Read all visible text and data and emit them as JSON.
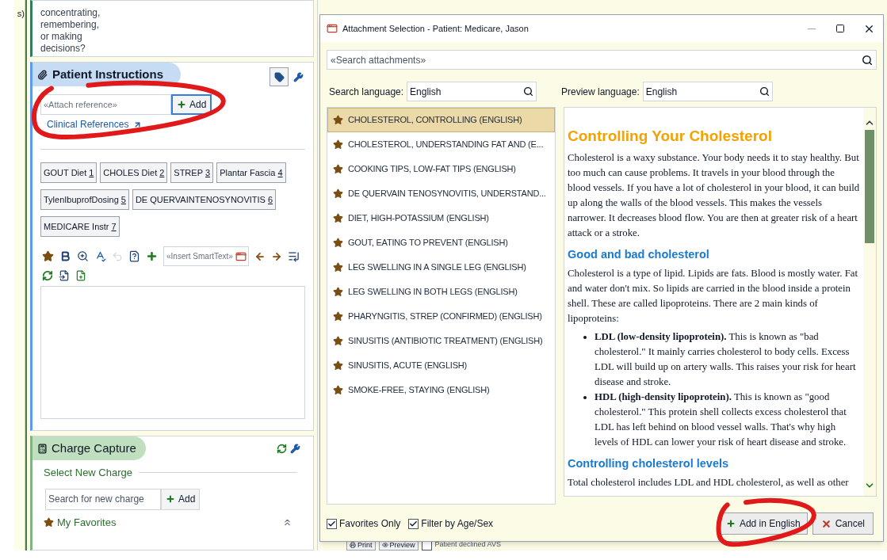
{
  "sidebar_fragment": {
    "text": "s)"
  },
  "question_card": {
    "lines": [
      "concentrating,",
      "remembering,",
      "or making",
      "decisions?"
    ]
  },
  "patient_instructions": {
    "title": "Patient Instructions",
    "attach_placeholder": "«Attach reference»",
    "add_button": "Add",
    "clinical_references_link": "Clinical References",
    "instructions": [
      {
        "label": "GOUT Diet",
        "number": "1"
      },
      {
        "label": "CHOLES Diet",
        "number": "2"
      },
      {
        "label": "STREP",
        "number": "3"
      },
      {
        "label": "Plantar Fascia",
        "number": "4"
      },
      {
        "label": "TylenIbuprofDosing",
        "number": "5"
      },
      {
        "label": "DE QUERVAINTENOSYNOVITIS",
        "number": "6"
      },
      {
        "label": "MEDICARE Instr",
        "number": "7"
      }
    ],
    "smarttext_placeholder": "«Insert SmartText»"
  },
  "charge_capture": {
    "title": "Charge Capture",
    "section_label": "Select New Charge",
    "search_placeholder": "Search for new charge",
    "add_button": "Add",
    "favorites_label": "My Favorites"
  },
  "background_footer": {
    "buttons": [
      "Print",
      "Preview"
    ],
    "checkbox": {
      "label": "Patient declined AVS",
      "checked": false
    }
  },
  "dialog": {
    "title": "Attachment Selection - Patient: Medicare, Jason",
    "search_placeholder": "«Search attachments»",
    "search_language": {
      "label": "Search language:",
      "value": "English"
    },
    "preview_language": {
      "label": "Preview language:",
      "value": "English"
    },
    "attachments": [
      {
        "label": "CHOLESTEROL, CONTROLLING (ENGLISH)",
        "selected": true
      },
      {
        "label": "CHOLESTEROL, UNDERSTANDING FAT AND (E...",
        "selected": false
      },
      {
        "label": "COOKING TIPS, LOW-FAT TIPS (ENGLISH)",
        "selected": false
      },
      {
        "label": "DE QUERVAIN TENOSYNOVITIS, UNDERSTAND...",
        "selected": false
      },
      {
        "label": "DIET, HIGH-POTASSIUM (ENGLISH)",
        "selected": false
      },
      {
        "label": "GOUT, EATING TO PREVENT (ENGLISH)",
        "selected": false
      },
      {
        "label": "LEG SWELLING IN A SINGLE LEG (ENGLISH)",
        "selected": false
      },
      {
        "label": "LEG SWELLING IN BOTH LEGS (ENGLISH)",
        "selected": false
      },
      {
        "label": "PHARYNGITIS, STREP (CONFIRMED) (ENGLISH)",
        "selected": false
      },
      {
        "label": "SINUSITIS (ANTIBIOTIC TREATMENT) (ENGLISH)",
        "selected": false
      },
      {
        "label": "SINUSITIS, ACUTE (ENGLISH)",
        "selected": false
      },
      {
        "label": "SMOKE-FREE, STAYING (ENGLISH)",
        "selected": false
      }
    ],
    "preview": [
      {
        "kind": "title",
        "text": "Controlling Your Cholesterol"
      },
      {
        "kind": "paragraph",
        "text": "Cholesterol is a waxy substance. Your body needs it to stay healthy. But too much can cause problems. It travels in your blood through the blood vessels. If you have a lot of cholesterol in your blood, it can build up along the walls of the blood vessels. This makes the vessels narrower. It decreases blood flow. You are then at greater risk of a heart attack or a stroke."
      },
      {
        "kind": "heading",
        "text": "Good and bad cholesterol"
      },
      {
        "kind": "paragraph",
        "text": "Cholesterol is a type of lipid. Lipids are fats. Blood is mostly water. Fat and water don't mix. So lipids are carried in the blood inside a protein shell. These are called lipoproteins. There are 2 main kinds of lipoproteins:"
      },
      {
        "kind": "bullet",
        "text": "**LDL (low-density lipoprotein).** This is known as \"bad cholesterol.\" It mainly carries cholesterol to body cells. Excess LDL will build up on artery walls. This raises your risk for heart disease and stroke."
      },
      {
        "kind": "bullet",
        "text": "**HDL (high-density lipoprotein).** This is known as \"good cholesterol.\" This protein shell collects excess cholesterol that LDL has left behind on blood vessel walls. That's why high levels of HDL can lower your risk of heart disease and stroke."
      },
      {
        "kind": "heading",
        "text": "Controlling cholesterol levels"
      },
      {
        "kind": "paragraph",
        "text": "Total cholesterol includes LDL and HDL cholesterol, as well as other"
      }
    ],
    "favorites_only": {
      "label": "Favorites Only",
      "checked": true
    },
    "filter_age_sex": {
      "label": "Filter by Age/Sex",
      "checked": true
    },
    "add_button": "Add in English",
    "cancel_button": "Cancel"
  }
}
